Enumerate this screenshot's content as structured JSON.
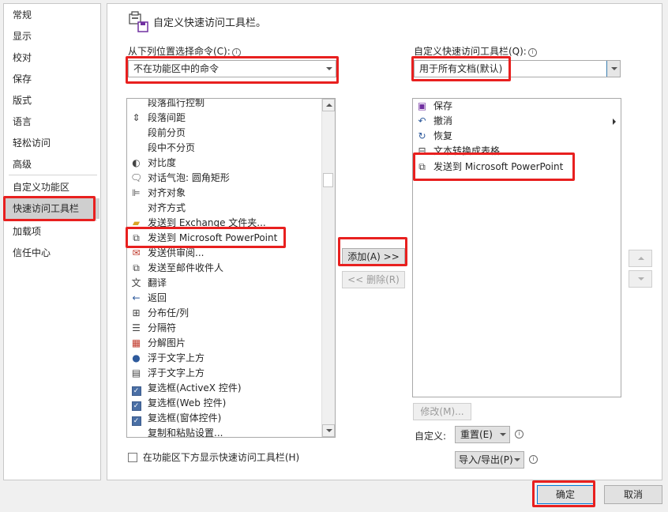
{
  "nav": {
    "items": [
      "常规",
      "显示",
      "校对",
      "保存",
      "版式",
      "语言",
      "轻松访问",
      "高级",
      "自定义功能区",
      "快速访问工具栏",
      "加载项",
      "信任中心"
    ]
  },
  "header": {
    "title": "自定义快速访问工具栏。"
  },
  "left": {
    "label": "从下列位置选择命令(C):",
    "combo_value": "不在功能区中的命令",
    "items": [
      "段落孤行控制",
      "段落间距",
      "段前分页",
      "段中不分页",
      "对比度",
      "对话气泡: 圆角矩形",
      "对齐对象",
      "对齐方式",
      "发送到 Exchange 文件夹...",
      "发送到 Microsoft PowerPoint",
      "发送供审阅...",
      "发送至邮件收件人",
      "翻译",
      "返回",
      "分布任/列",
      "分隔符",
      "分解图片",
      "浮于文字上方",
      "浮于文字上方",
      "复选框(ActiveX 控件)",
      "复选框(Web 控件)",
      "复选框(窗体控件)",
      "复制和粘贴设置..."
    ],
    "checkbox_label": "在功能区下方显示快速访问工具栏(H)"
  },
  "middle": {
    "add_label": "添加(A) >>",
    "remove_label": "<< 删除(R)"
  },
  "right": {
    "label": "自定义快速访问工具栏(Q):",
    "combo_value": "用于所有文档(默认)",
    "items": [
      "保存",
      "撤消",
      "恢复",
      "文本转换成表格...",
      "发送到 Microsoft PowerPoint"
    ],
    "modify_label": "修改(M)...",
    "customize_label": "自定义:",
    "reset_label": "重置(E)",
    "import_export_label": "导入/导出(P)"
  },
  "footer": {
    "ok_label": "确定",
    "cancel_label": "取消"
  },
  "colors": {
    "highlight": "#e8201f",
    "selected": "#cfcfcf"
  }
}
